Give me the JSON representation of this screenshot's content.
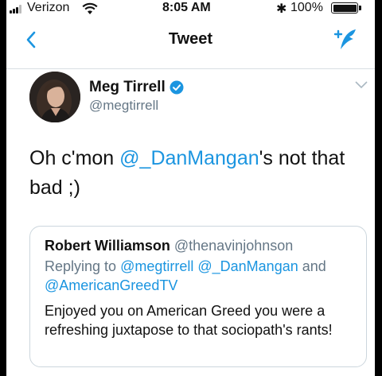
{
  "status_bar": {
    "carrier": "Verizon",
    "time": "8:05 AM",
    "battery_percent": "100%",
    "icons": [
      "signal-icon",
      "wifi-icon",
      "bluetooth-icon",
      "battery-icon"
    ]
  },
  "nav": {
    "title": "Tweet",
    "back_icon": "chevron-left-icon",
    "compose_icon": "compose-tweet-icon"
  },
  "tweet": {
    "author_name": "Meg Tirrell",
    "author_handle": "@megtirrell",
    "verified": true,
    "text_before": "Oh c'mon ",
    "mention": "@_DanMangan",
    "text_after": "'s not that bad ;)"
  },
  "quoted_tweet": {
    "author_name": "Robert Williamson",
    "author_handle": "@thenavinjohnson",
    "replying_prefix": "Replying to ",
    "replying_mention_1": "@megtirrell",
    "replying_mention_2": "@_DanMangan",
    "replying_and": " and ",
    "replying_mention_3": "@AmericanGreedTV",
    "body": "Enjoyed you on American Greed you were a refreshing juxtapose to that sociopath's rants!"
  },
  "colors": {
    "accent": "#1b95e0",
    "secondary_text": "#657786",
    "border": "#ccd6dd"
  }
}
